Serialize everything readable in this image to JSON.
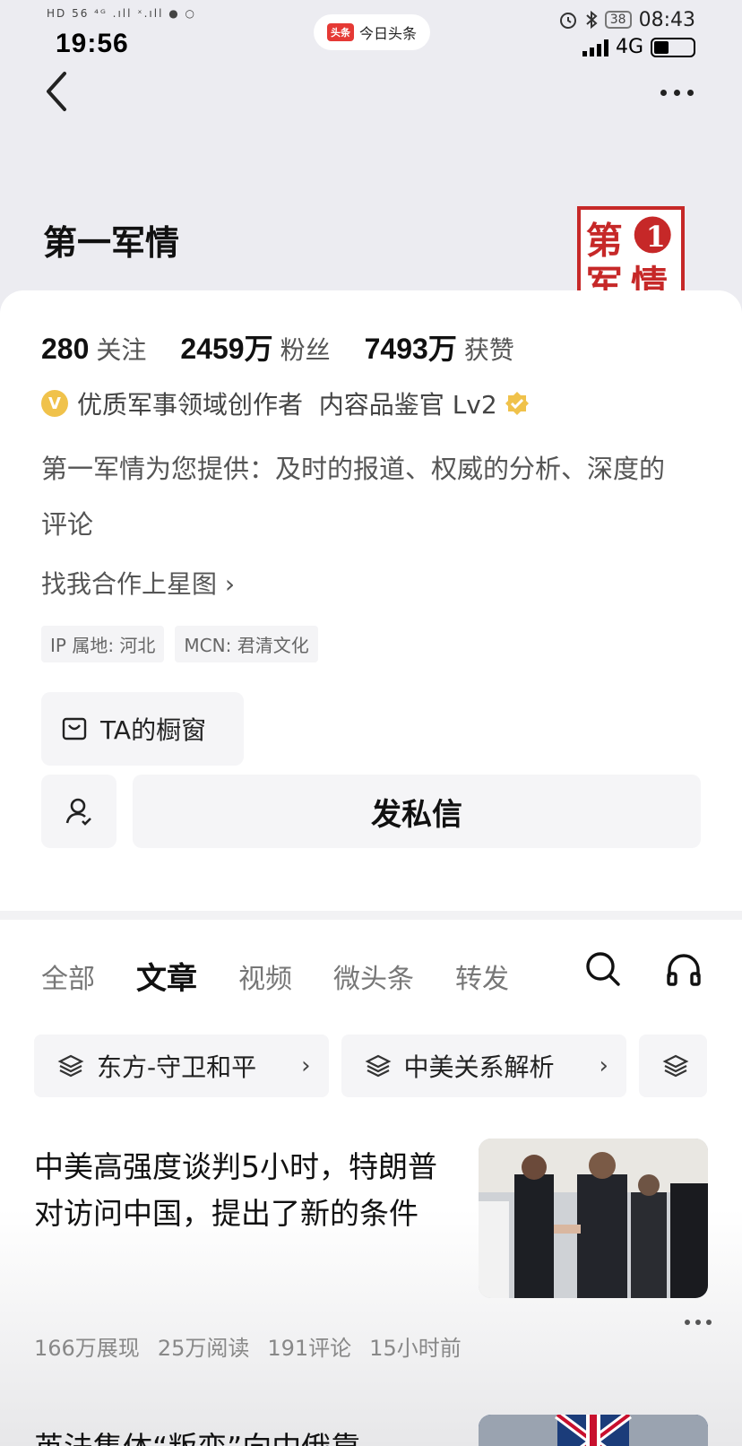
{
  "outer_status": {
    "time": "19:56",
    "left_icons": "HD 56 ⁴ᴳ .ıll ˣ.ıll ● ○",
    "app_pill": {
      "logo": "头条",
      "label": "今日头条"
    },
    "battery_pct": "38",
    "clock": "08:43",
    "network": "4G"
  },
  "profile": {
    "name": "第一军情",
    "stats": [
      {
        "num": "280",
        "label": "关注"
      },
      {
        "num": "2459万",
        "label": "粉丝"
      },
      {
        "num": "7493万",
        "label": "获赞"
      }
    ],
    "badge_v": "V",
    "badge_text": "优质军事领域创作者  内容品鉴官 Lv2",
    "bio": "第一军情为您提供：及时的报道、权威的分析、深度的评论",
    "coop_link": "找我合作上星图 ›",
    "tags": [
      "IP 属地: 河北",
      "MCN: 君清文化"
    ],
    "shop_label": "TA的橱窗",
    "message_label": "发私信"
  },
  "tabs": [
    "全部",
    "文章",
    "视频",
    "微头条",
    "转发"
  ],
  "active_tab": "文章",
  "collections": [
    {
      "label": "东方-守卫和平"
    },
    {
      "label": "中美关系解析"
    }
  ],
  "articles": [
    {
      "title": "中美高强度谈判5小时，特朗普对访问中国，提出了新的条件",
      "meta": [
        "166万展现",
        "25万阅读",
        "191评论",
        "15小时前"
      ]
    },
    {
      "title": "英法集体“叛变”向中俄靠"
    }
  ],
  "colors": {
    "avatar_red": "#c62828",
    "badge_gold": "#f0c24b"
  }
}
